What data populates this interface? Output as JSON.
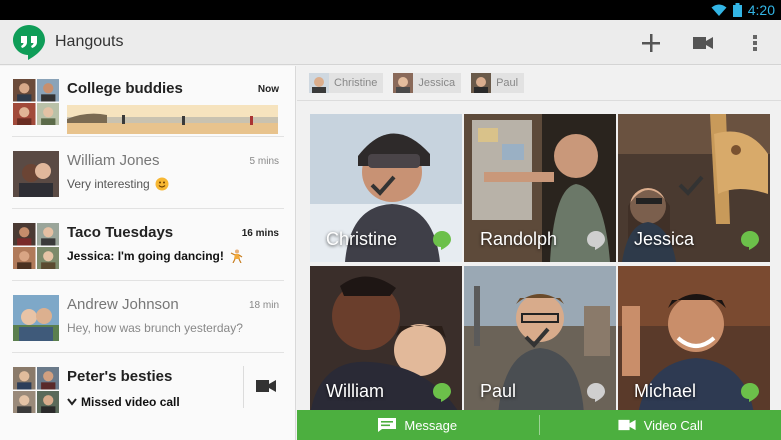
{
  "status_bar": {
    "time": "4:20",
    "icons": [
      "wifi-icon",
      "battery-icon"
    ]
  },
  "app": {
    "title": "Hangouts",
    "logo_icon": "hangouts-logo",
    "accent": "#4caf3f"
  },
  "action_bar": {
    "actions": [
      "add-icon",
      "video-call-icon",
      "overflow-menu-icon"
    ]
  },
  "conversations": [
    {
      "name": "College buddies",
      "time": "Now",
      "snippet": "",
      "unread": true,
      "has_photo": true
    },
    {
      "name": "William Jones",
      "time": "5 mins",
      "snippet": "Very interesting",
      "unread": false
    },
    {
      "name": "Taco Tuesdays",
      "time": "16 mins",
      "snippet": "Jessica: I'm going dancing!",
      "unread": true
    },
    {
      "name": "Andrew Johnson",
      "time": "18 min",
      "snippet": "Hey, how was brunch yesterday?",
      "unread": false
    },
    {
      "name": "Peter's besties",
      "time": "",
      "snippet": "Missed video call",
      "unread": true,
      "action_icon": "video-call-icon"
    }
  ],
  "participants_chips": [
    {
      "name": "Christine"
    },
    {
      "name": "Jessica"
    },
    {
      "name": "Paul"
    }
  ],
  "tiles": [
    {
      "name": "Christine",
      "selected": true,
      "online": true
    },
    {
      "name": "Randolph",
      "selected": false,
      "online": false
    },
    {
      "name": "Jessica",
      "selected": true,
      "online": true
    },
    {
      "name": "William",
      "selected": false,
      "online": true
    },
    {
      "name": "Paul",
      "selected": true,
      "online": false
    },
    {
      "name": "Michael",
      "selected": false,
      "online": true
    }
  ],
  "bottom_actions": {
    "message_label": "Message",
    "video_call_label": "Video Call"
  }
}
